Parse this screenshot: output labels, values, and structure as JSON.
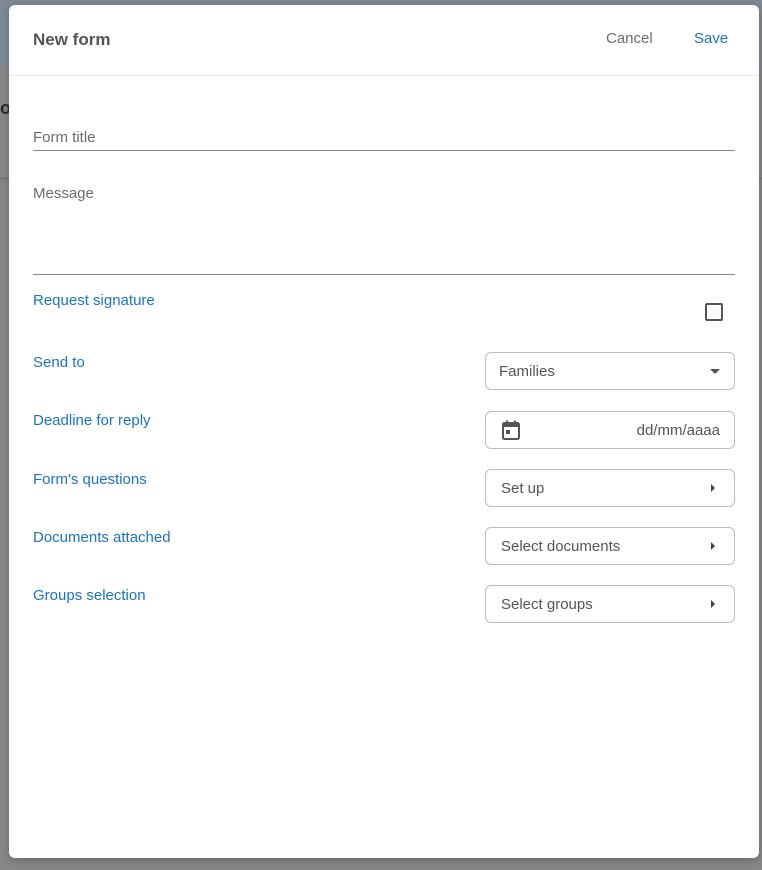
{
  "dialog": {
    "title": "New form",
    "cancel_label": "Cancel",
    "save_label": "Save"
  },
  "fields": {
    "title_placeholder": "Form title",
    "message_placeholder": "Message"
  },
  "rows": {
    "request_signature": {
      "label": "Request signature",
      "checked": false
    },
    "send_to": {
      "label": "Send to",
      "selected": "Families"
    },
    "deadline": {
      "label": "Deadline for reply",
      "placeholder": "dd/mm/aaaa",
      "icon": "calendar-icon"
    },
    "questions": {
      "label": "Form's questions",
      "action": "Set up"
    },
    "documents": {
      "label": "Documents attached",
      "action": "Select documents"
    },
    "groups": {
      "label": "Groups selection",
      "action": "Select groups"
    }
  },
  "colors": {
    "accent": "#1a73c8",
    "label_gray": "#545454",
    "border": "#bdbdbd"
  }
}
